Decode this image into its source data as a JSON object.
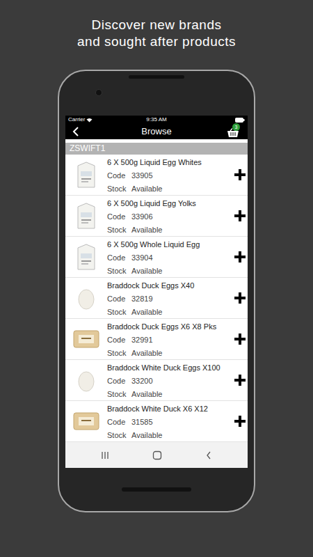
{
  "headline": [
    "Discover new brands",
    "and sought after products"
  ],
  "status_bar": {
    "carrier": "Carrier",
    "time": "9:35 AM"
  },
  "nav": {
    "title": "Browse",
    "cart_count": "3"
  },
  "section": "ZSWIFT1",
  "products": [
    {
      "name": "6 X 500g Liquid Egg Whites",
      "code_label": "Code",
      "code": "33905",
      "stock_label": "Stock",
      "stock": "Available",
      "kind": "carton"
    },
    {
      "name": "6 X 500g Liquid Egg Yolks",
      "code_label": "Code",
      "code": "33906",
      "stock_label": "Stock",
      "stock": "Available",
      "kind": "carton"
    },
    {
      "name": "6 X 500g Whole Liquid Egg",
      "code_label": "Code",
      "code": "33904",
      "stock_label": "Stock",
      "stock": "Available",
      "kind": "carton"
    },
    {
      "name": "Braddock Duck Eggs X40",
      "code_label": "Code",
      "code": "32819",
      "stock_label": "Stock",
      "stock": "Available",
      "kind": "egg"
    },
    {
      "name": "Braddock Duck Eggs X6 X8 Pks",
      "code_label": "Code",
      "code": "32991",
      "stock_label": "Stock",
      "stock": "Available",
      "kind": "box"
    },
    {
      "name": "Braddock White Duck Eggs X100",
      "code_label": "Code",
      "code": "33200",
      "stock_label": "Stock",
      "stock": "Available",
      "kind": "egg"
    },
    {
      "name": "Braddock White Duck X6 X12",
      "code_label": "Code",
      "code": "31585",
      "stock_label": "Stock",
      "stock": "Available",
      "kind": "box"
    }
  ]
}
